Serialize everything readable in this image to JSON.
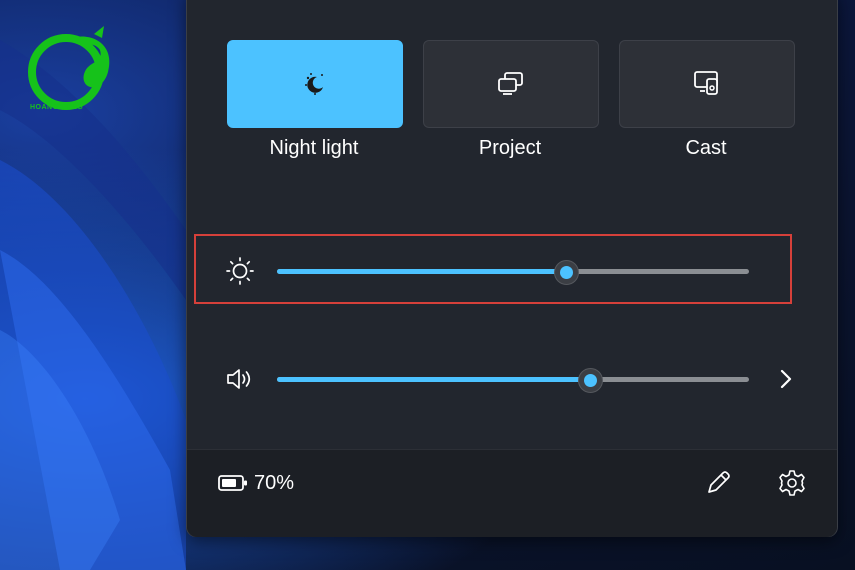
{
  "logo": {
    "text": "HOANG LONG"
  },
  "quick_actions": [
    {
      "label": "Night light",
      "icon": "night-light-icon",
      "active": true
    },
    {
      "label": "Project",
      "icon": "project-icon",
      "active": false
    },
    {
      "label": "Cast",
      "icon": "cast-icon",
      "active": false
    }
  ],
  "brightness": {
    "icon": "sun-icon",
    "value_percent": 61
  },
  "volume": {
    "icon": "speaker-icon",
    "value_percent": 66,
    "expand_icon": "chevron-right-icon"
  },
  "footer": {
    "battery_icon": "battery-icon",
    "battery_text": "70%",
    "edit_icon": "pencil-icon",
    "settings_icon": "gear-icon"
  },
  "colors": {
    "accent": "#4cc2ff",
    "panel": "#22262e",
    "highlight": "#d6403a"
  }
}
